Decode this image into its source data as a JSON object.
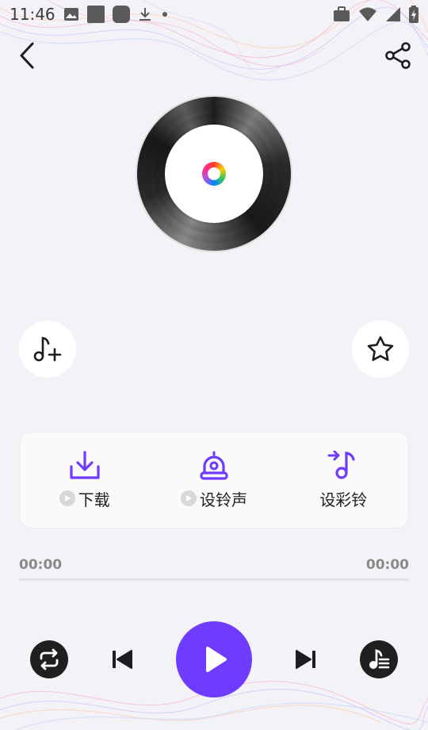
{
  "status_bar": {
    "time": "11:46",
    "left_icons": [
      "image-icon",
      "square-icon",
      "rounded-square-icon",
      "download-icon",
      "dot-icon"
    ],
    "right_icons": [
      "briefcase-icon",
      "wifi-icon",
      "signal-icon",
      "battery-icon"
    ]
  },
  "header": {
    "back_icon": "chevron-left-icon",
    "share_icon": "share-icon"
  },
  "disc": {
    "logo_icon": "app-logo-icon"
  },
  "side_buttons": {
    "add_icon": "music-note-plus-icon",
    "favorite_icon": "star-icon"
  },
  "actions": [
    {
      "label": "下载",
      "icon": "download-tray-icon",
      "has_video_badge": true
    },
    {
      "label": "设铃声",
      "icon": "alarm-bell-icon",
      "has_video_badge": true
    },
    {
      "label": "设彩铃",
      "icon": "music-note-arrow-icon",
      "has_video_badge": false
    }
  ],
  "player": {
    "current_time": "00:00",
    "total_time": "00:00",
    "progress": 0
  },
  "controls": {
    "repeat_icon": "repeat-icon",
    "prev_icon": "skip-previous-icon",
    "play_icon": "play-icon",
    "next_icon": "skip-next-icon",
    "playlist_icon": "playlist-icon"
  },
  "colors": {
    "accent": "#6f3bff",
    "background": "#f3f2f6",
    "dark_button": "#1f1f1f"
  }
}
